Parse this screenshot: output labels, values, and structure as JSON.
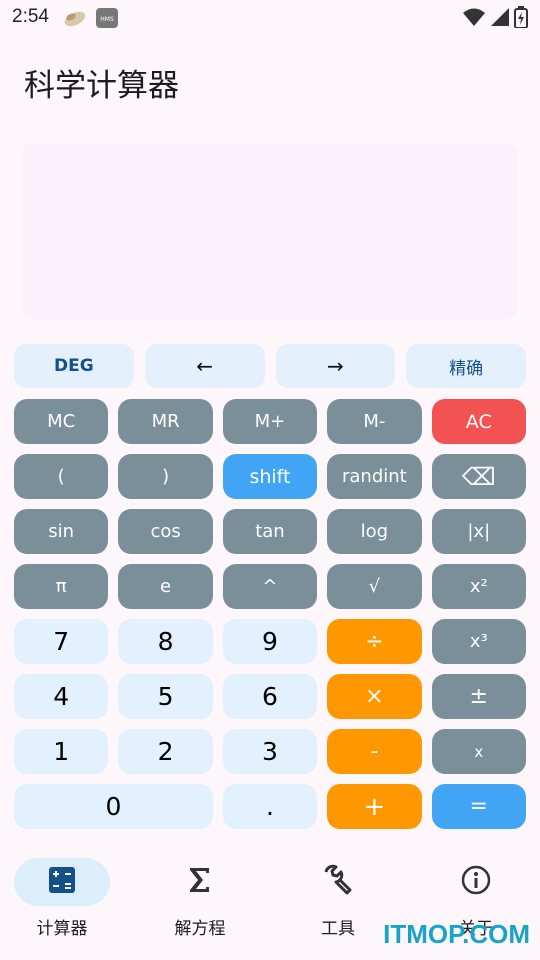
{
  "status_bar": {
    "time": "2:54",
    "notif_badge": "HMS"
  },
  "app": {
    "title": "科学计算器"
  },
  "display": {
    "expression": "",
    "result": ""
  },
  "top_row": {
    "deg": "DEG",
    "left": "←",
    "right": "→",
    "precision": "精确"
  },
  "keys": [
    [
      "MC",
      "MR",
      "M+",
      "M-",
      "AC"
    ],
    [
      "(",
      ")",
      "shift",
      "randint",
      "⌫"
    ],
    [
      "sin",
      "cos",
      "tan",
      "log",
      "|x|"
    ],
    [
      "π",
      "e",
      "^",
      "√",
      "x²"
    ],
    [
      "7",
      "8",
      "9",
      "÷",
      "x³"
    ],
    [
      "4",
      "5",
      "6",
      "×",
      "±"
    ],
    [
      "1",
      "2",
      "3",
      "-",
      "x"
    ],
    [
      "0",
      ".",
      "+",
      "="
    ]
  ],
  "nav": {
    "calculator": "计算器",
    "equations": "解方程",
    "tools": "工具",
    "about": "关于"
  },
  "watermark": "ITMOP.COM",
  "colors": {
    "accent": "#42a4f5",
    "operator": "#ff9800",
    "clear": "#f35252",
    "function": "#7a8f99",
    "digit": "#e2f1fd"
  }
}
